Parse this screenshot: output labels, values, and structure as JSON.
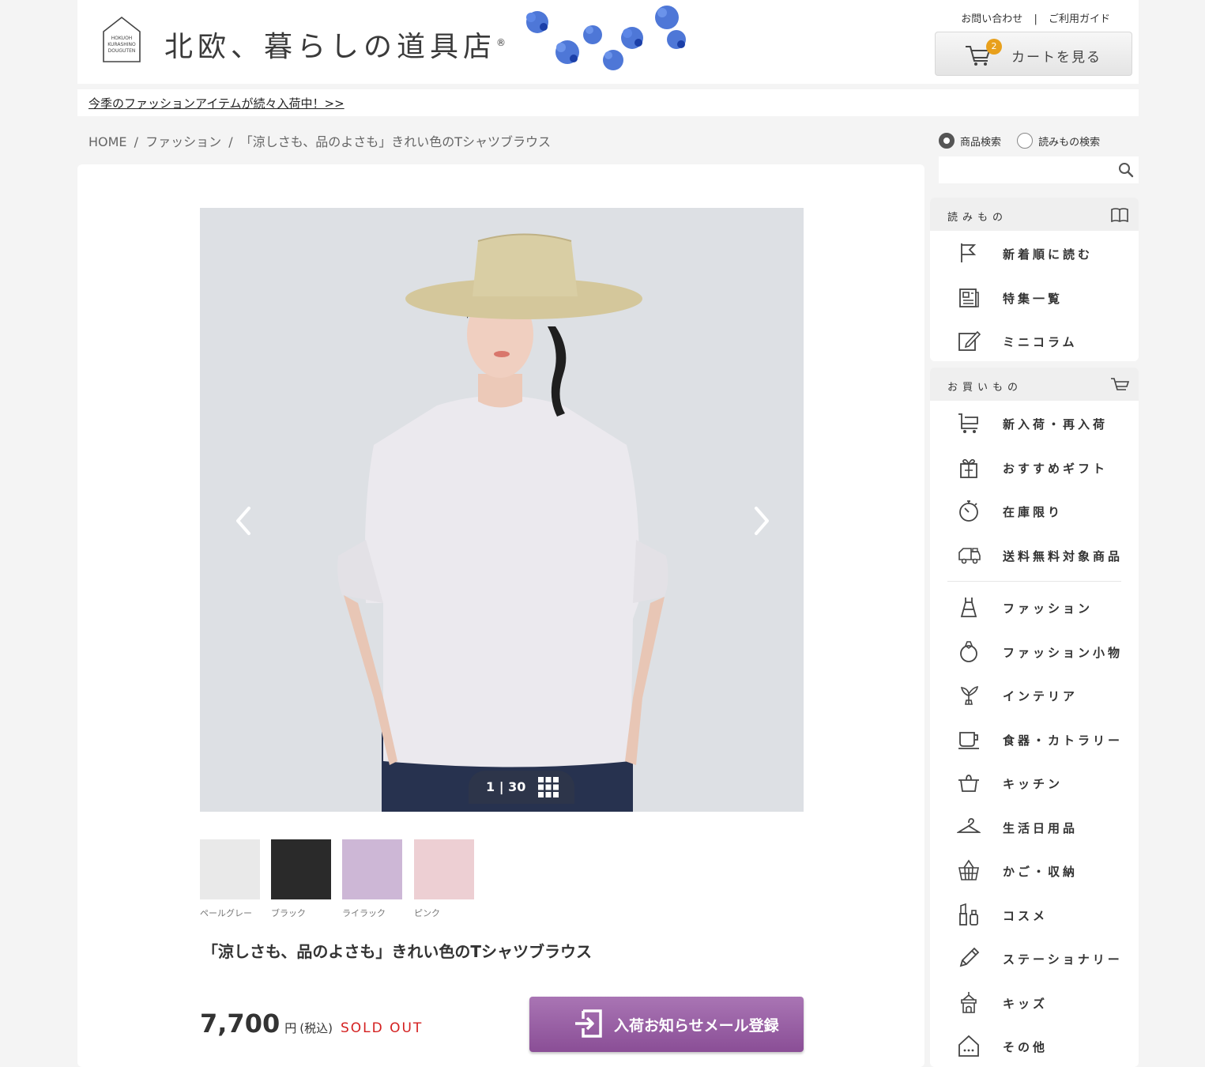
{
  "header": {
    "logo_badge_text": "HOKUOH KURASHINO DOUGUTEN",
    "site_name": "北欧、暮らしの道具店",
    "registered_mark": "®",
    "contact_label": "お問い合わせ",
    "separator": "|",
    "guide_label": "ご利用ガイド",
    "cart_label": "カートを見る",
    "cart_count": "2"
  },
  "notice": {
    "text": "今季のファッションアイテムが続々入荷中！>>"
  },
  "breadcrumb": {
    "items": [
      "HOME",
      "/",
      "ファッション",
      "/",
      "「涼しさも、品のよさも」きれい色のTシャツブラウス"
    ]
  },
  "search": {
    "option_product": "商品検索",
    "option_reading": "読みもの検索",
    "selected": "商品検索",
    "value": "",
    "placeholder": ""
  },
  "gallery": {
    "counter_current": "1",
    "counter_sep": "|",
    "counter_total": "30",
    "thumbnails": [
      {
        "label": "ペールグレー",
        "color": "#e9e9e9"
      },
      {
        "label": "ブラック",
        "color": "#2a2a2a"
      },
      {
        "label": "ライラック",
        "color": "#cdb7d6"
      },
      {
        "label": "ピンク",
        "color": "#edcfd3"
      }
    ]
  },
  "product": {
    "title": "「涼しさも、品のよさも」きれい色のTシャツブラウス",
    "price": "7,700",
    "price_unit": "円",
    "price_tax": "(税込)",
    "status": "SOLD OUT",
    "notify_button": "入荷お知らせメール登録"
  },
  "sidebar": {
    "reading": {
      "title": "読みもの",
      "items": [
        {
          "label": "新着順に読む",
          "icon": "flag-icon"
        },
        {
          "label": "特集一覧",
          "icon": "newspaper-icon"
        },
        {
          "label": "ミニコラム",
          "icon": "pencil-note-icon"
        }
      ]
    },
    "shopping": {
      "title": "お買いもの",
      "top_items": [
        {
          "label": "新入荷・再入荷",
          "icon": "cart-new-icon"
        },
        {
          "label": "おすすめギフト",
          "icon": "gift-icon"
        },
        {
          "label": "在庫限り",
          "icon": "stopwatch-icon"
        },
        {
          "label": "送料無料対象商品",
          "icon": "truck-icon"
        }
      ],
      "categories": [
        {
          "label": "ファッション",
          "icon": "dress-icon"
        },
        {
          "label": "ファッション小物",
          "icon": "ring-icon"
        },
        {
          "label": "インテリア",
          "icon": "plant-icon"
        },
        {
          "label": "食器・カトラリー",
          "icon": "cup-icon"
        },
        {
          "label": "キッチン",
          "icon": "pot-icon"
        },
        {
          "label": "生活日用品",
          "icon": "hanger-icon"
        },
        {
          "label": "かご・収納",
          "icon": "basket-icon"
        },
        {
          "label": "コスメ",
          "icon": "cosmetics-icon"
        },
        {
          "label": "ステーショナリー",
          "icon": "pen-icon"
        },
        {
          "label": "キッズ",
          "icon": "kids-icon"
        },
        {
          "label": "その他",
          "icon": "house-icon"
        }
      ]
    }
  },
  "colors": {
    "accent_purple": "#9a61a5",
    "sold_out_red": "#d42020",
    "badge_orange": "#e8a01c"
  }
}
